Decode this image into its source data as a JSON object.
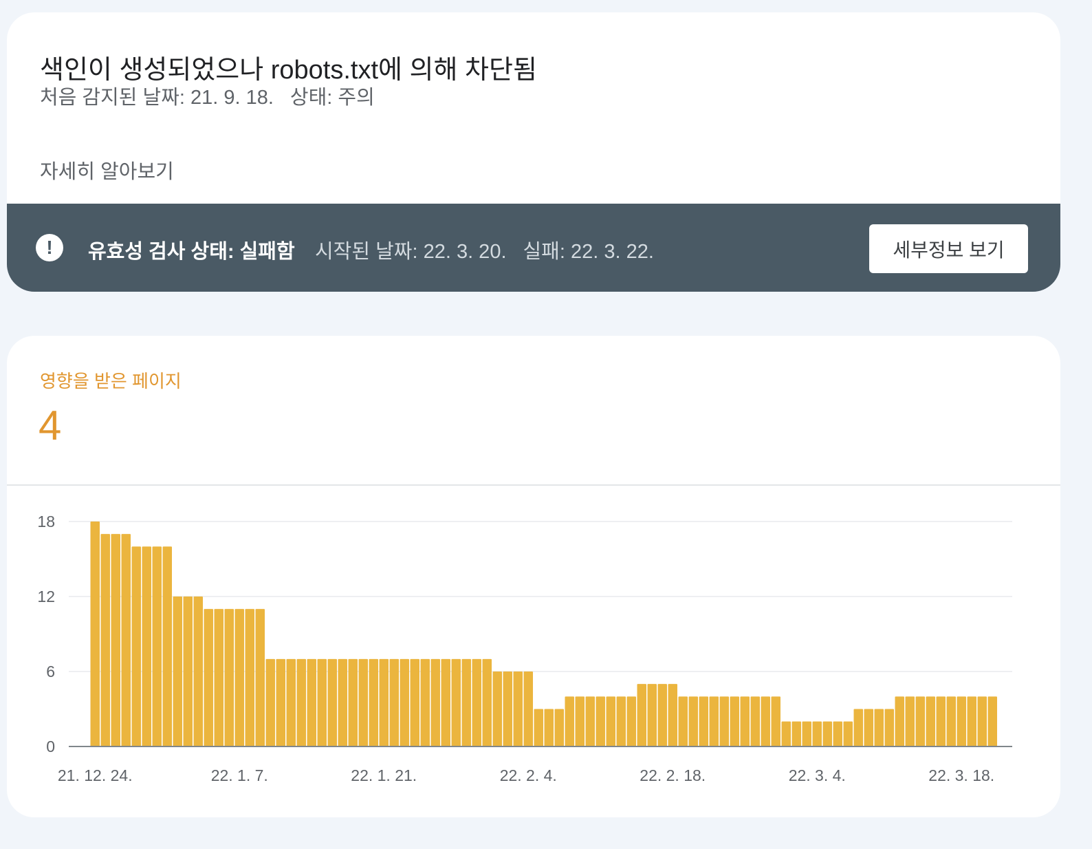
{
  "issue": {
    "title": "색인이 생성되었으나 robots.txt에 의해 차단됨",
    "first_detected": "처음 감지된 날짜: 21. 9. 18.",
    "status": "상태: 주의",
    "learn_more": "자세히 알아보기"
  },
  "validation": {
    "label": "유효성 검사 상태: 실패함",
    "started": "시작된 날짜: 22. 3. 20.",
    "failed": "실패: 22. 3. 22.",
    "details_button": "세부정보 보기",
    "icon": "alert-circle-icon"
  },
  "metric": {
    "label": "영향을 받은 페이지",
    "value": "4"
  },
  "colors": {
    "accent": "#e1962f",
    "bar": "#ebb53e",
    "banner": "#4a5a65"
  },
  "chart_data": {
    "type": "bar",
    "ylim": [
      0,
      18
    ],
    "y_ticks": [
      0,
      6,
      12,
      18
    ],
    "x_tick_labels": [
      "21. 12. 24.",
      "22. 1. 7.",
      "22. 1. 21.",
      "22. 2. 4.",
      "22. 2. 18.",
      "22. 3. 4.",
      "22. 3. 18."
    ],
    "x_tick_indices": [
      0,
      14,
      28,
      42,
      56,
      70,
      84
    ],
    "grid": true,
    "series": [
      {
        "values": [
          18,
          17,
          17,
          17,
          16,
          16,
          16,
          16,
          12,
          12,
          12,
          11,
          11,
          11,
          11,
          11,
          11,
          7,
          7,
          7,
          7,
          7,
          7,
          7,
          7,
          7,
          7,
          7,
          7,
          7,
          7,
          7,
          7,
          7,
          7,
          7,
          7,
          7,
          7,
          6,
          6,
          6,
          6,
          3,
          3,
          3,
          4,
          4,
          4,
          4,
          4,
          4,
          4,
          5,
          5,
          5,
          5,
          4,
          4,
          4,
          4,
          4,
          4,
          4,
          4,
          4,
          4,
          2,
          2,
          2,
          2,
          2,
          2,
          2,
          3,
          3,
          3,
          3,
          4,
          4,
          4,
          4,
          4,
          4,
          4,
          4,
          4,
          4
        ]
      }
    ]
  }
}
